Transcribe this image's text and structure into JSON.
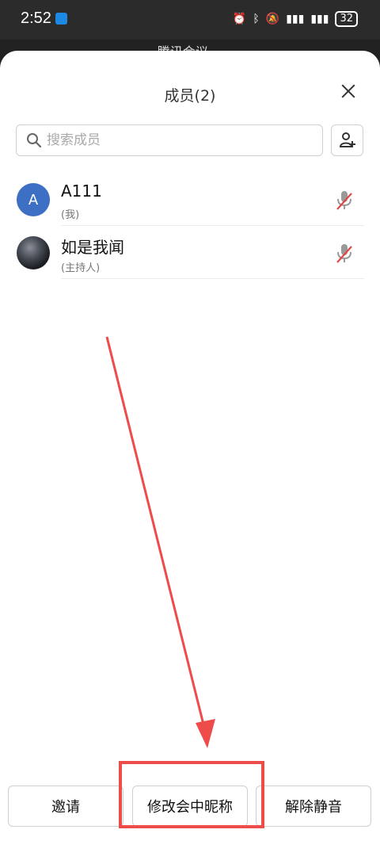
{
  "status_bar": {
    "time": "2:52",
    "battery": "32"
  },
  "behind_title": "腾讯会议",
  "sheet": {
    "title": "成员(2)"
  },
  "search": {
    "placeholder": "搜索成员"
  },
  "members": [
    {
      "name": "A111",
      "role": "(我)",
      "avatar_letter": "A"
    },
    {
      "name": "如是我闻",
      "role": "(主持人)"
    }
  ],
  "actions": {
    "invite": "邀请",
    "rename": "修改会中昵称",
    "unmute": "解除静音"
  },
  "colors": {
    "annotation": "#ee4b4b",
    "avatar_blue": "#3d70c4",
    "muted_mic": "#e04848"
  }
}
